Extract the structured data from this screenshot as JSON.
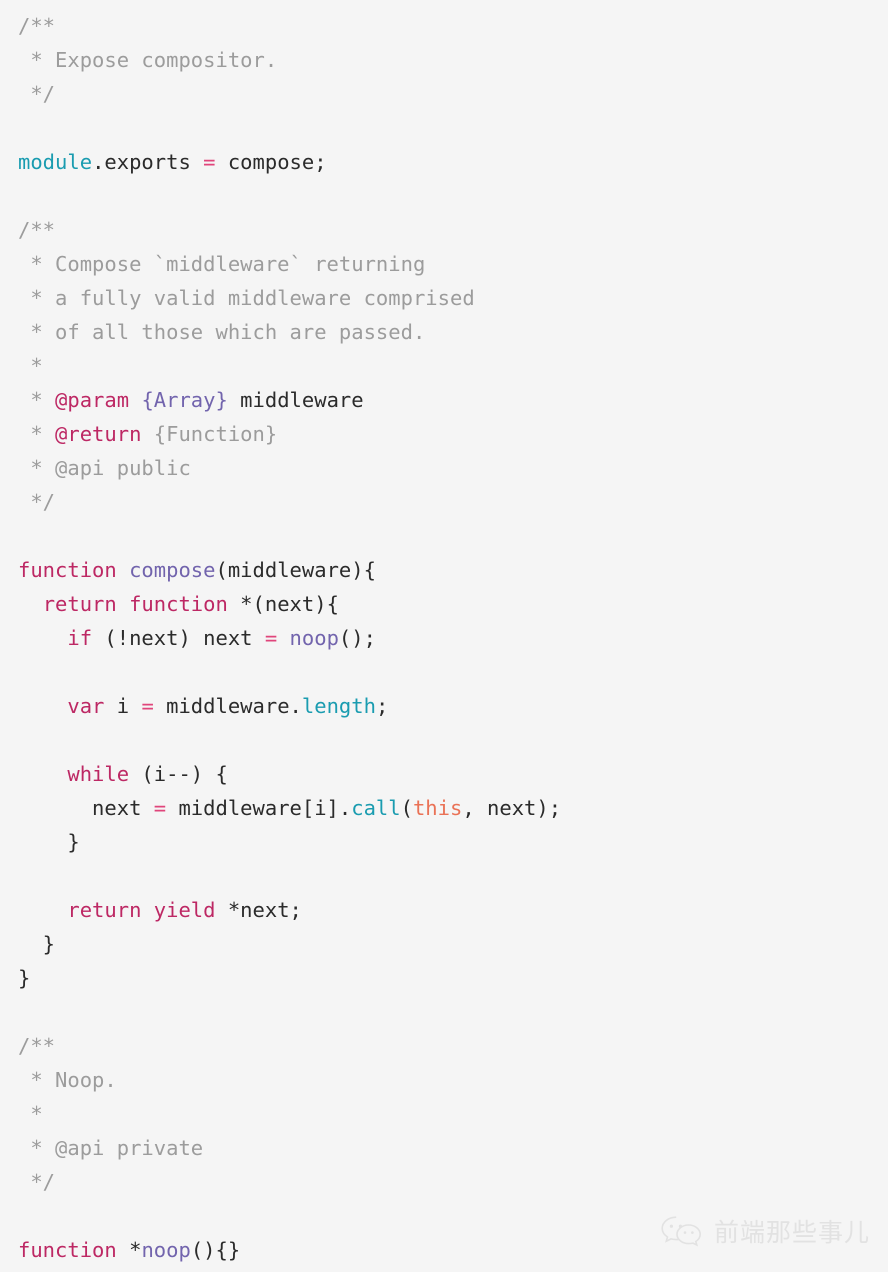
{
  "document": {
    "kind": "source-code-screenshot",
    "language": "javascript",
    "background_color": "#f5f5f5"
  },
  "theme": {
    "comment": "#9c9c9c",
    "keyword": "#bd2864",
    "operator": "#e0457b",
    "function": "#7264ad",
    "property": "#1a9cb0",
    "this_keyword": "#ea7256",
    "plain": "#2b2b2b",
    "watermark": "#e2e2e2"
  },
  "code": {
    "lines": [
      {
        "id": "l1",
        "tokens": [
          {
            "t": "/**",
            "c": "t-comment"
          }
        ]
      },
      {
        "id": "l2",
        "tokens": [
          {
            "t": " * Expose compositor.",
            "c": "t-comment"
          }
        ]
      },
      {
        "id": "l3",
        "tokens": [
          {
            "t": " */",
            "c": "t-comment"
          }
        ]
      },
      {
        "id": "l4",
        "tokens": [
          {
            "t": "",
            "c": "t-plain"
          }
        ]
      },
      {
        "id": "l5",
        "tokens": [
          {
            "t": "module",
            "c": "t-builtin"
          },
          {
            "t": ".exports ",
            "c": "t-plain"
          },
          {
            "t": "=",
            "c": "t-operator"
          },
          {
            "t": " compose;",
            "c": "t-plain"
          }
        ]
      },
      {
        "id": "l6",
        "tokens": [
          {
            "t": "",
            "c": "t-plain"
          }
        ]
      },
      {
        "id": "l7",
        "tokens": [
          {
            "t": "/**",
            "c": "t-comment"
          }
        ]
      },
      {
        "id": "l8",
        "tokens": [
          {
            "t": " * Compose `middleware` returning",
            "c": "t-comment"
          }
        ]
      },
      {
        "id": "l9",
        "tokens": [
          {
            "t": " * a fully valid middleware comprised",
            "c": "t-comment"
          }
        ]
      },
      {
        "id": "l10",
        "tokens": [
          {
            "t": " * of all those which are passed.",
            "c": "t-comment"
          }
        ]
      },
      {
        "id": "l11",
        "tokens": [
          {
            "t": " *",
            "c": "t-comment"
          }
        ]
      },
      {
        "id": "l12",
        "tokens": [
          {
            "t": " * ",
            "c": "t-comment"
          },
          {
            "t": "@param",
            "c": "t-tag"
          },
          {
            "t": " ",
            "c": "t-comment"
          },
          {
            "t": "{Array}",
            "c": "t-type"
          },
          {
            "t": " middleware",
            "c": "t-plain"
          }
        ]
      },
      {
        "id": "l13",
        "tokens": [
          {
            "t": " * ",
            "c": "t-comment"
          },
          {
            "t": "@return",
            "c": "t-tag"
          },
          {
            "t": " {Function}",
            "c": "t-comment"
          }
        ]
      },
      {
        "id": "l14",
        "tokens": [
          {
            "t": " * @api public",
            "c": "t-comment"
          }
        ]
      },
      {
        "id": "l15",
        "tokens": [
          {
            "t": " */",
            "c": "t-comment"
          }
        ]
      },
      {
        "id": "l16",
        "tokens": [
          {
            "t": "",
            "c": "t-plain"
          }
        ]
      },
      {
        "id": "l17",
        "tokens": [
          {
            "t": "function",
            "c": "t-keyword"
          },
          {
            "t": " ",
            "c": "t-plain"
          },
          {
            "t": "compose",
            "c": "t-function"
          },
          {
            "t": "(middleware){",
            "c": "t-plain"
          }
        ]
      },
      {
        "id": "l18",
        "tokens": [
          {
            "t": "  ",
            "c": "t-plain"
          },
          {
            "t": "return",
            "c": "t-keyword"
          },
          {
            "t": " ",
            "c": "t-plain"
          },
          {
            "t": "function",
            "c": "t-keyword"
          },
          {
            "t": " *(next){",
            "c": "t-plain"
          }
        ]
      },
      {
        "id": "l19",
        "tokens": [
          {
            "t": "    ",
            "c": "t-plain"
          },
          {
            "t": "if",
            "c": "t-keyword"
          },
          {
            "t": " (!next) next ",
            "c": "t-plain"
          },
          {
            "t": "=",
            "c": "t-operator"
          },
          {
            "t": " ",
            "c": "t-plain"
          },
          {
            "t": "noop",
            "c": "t-function"
          },
          {
            "t": "();",
            "c": "t-plain"
          }
        ]
      },
      {
        "id": "l20",
        "tokens": [
          {
            "t": "",
            "c": "t-plain"
          }
        ]
      },
      {
        "id": "l21",
        "tokens": [
          {
            "t": "    ",
            "c": "t-plain"
          },
          {
            "t": "var",
            "c": "t-keyword"
          },
          {
            "t": " i ",
            "c": "t-plain"
          },
          {
            "t": "=",
            "c": "t-operator"
          },
          {
            "t": " middleware.",
            "c": "t-plain"
          },
          {
            "t": "length",
            "c": "t-property"
          },
          {
            "t": ";",
            "c": "t-plain"
          }
        ]
      },
      {
        "id": "l22",
        "tokens": [
          {
            "t": "",
            "c": "t-plain"
          }
        ]
      },
      {
        "id": "l23",
        "tokens": [
          {
            "t": "    ",
            "c": "t-plain"
          },
          {
            "t": "while",
            "c": "t-keyword"
          },
          {
            "t": " (i--) {",
            "c": "t-plain"
          }
        ]
      },
      {
        "id": "l24",
        "tokens": [
          {
            "t": "      next ",
            "c": "t-plain"
          },
          {
            "t": "=",
            "c": "t-operator"
          },
          {
            "t": " middleware[i].",
            "c": "t-plain"
          },
          {
            "t": "call",
            "c": "t-property"
          },
          {
            "t": "(",
            "c": "t-plain"
          },
          {
            "t": "this",
            "c": "t-this"
          },
          {
            "t": ", next);",
            "c": "t-plain"
          }
        ]
      },
      {
        "id": "l25",
        "tokens": [
          {
            "t": "    }",
            "c": "t-plain"
          }
        ]
      },
      {
        "id": "l26",
        "tokens": [
          {
            "t": "",
            "c": "t-plain"
          }
        ]
      },
      {
        "id": "l27",
        "tokens": [
          {
            "t": "    ",
            "c": "t-plain"
          },
          {
            "t": "return",
            "c": "t-keyword"
          },
          {
            "t": " ",
            "c": "t-plain"
          },
          {
            "t": "yield",
            "c": "t-keyword"
          },
          {
            "t": " *next;",
            "c": "t-plain"
          }
        ]
      },
      {
        "id": "l28",
        "tokens": [
          {
            "t": "  }",
            "c": "t-plain"
          }
        ]
      },
      {
        "id": "l29",
        "tokens": [
          {
            "t": "}",
            "c": "t-plain"
          }
        ]
      },
      {
        "id": "l30",
        "tokens": [
          {
            "t": "",
            "c": "t-plain"
          }
        ]
      },
      {
        "id": "l31",
        "tokens": [
          {
            "t": "/**",
            "c": "t-comment"
          }
        ]
      },
      {
        "id": "l32",
        "tokens": [
          {
            "t": " * Noop.",
            "c": "t-comment"
          }
        ]
      },
      {
        "id": "l33",
        "tokens": [
          {
            "t": " *",
            "c": "t-comment"
          }
        ]
      },
      {
        "id": "l34",
        "tokens": [
          {
            "t": " * @api private",
            "c": "t-comment"
          }
        ]
      },
      {
        "id": "l35",
        "tokens": [
          {
            "t": " */",
            "c": "t-comment"
          }
        ]
      },
      {
        "id": "l36",
        "tokens": [
          {
            "t": "",
            "c": "t-plain"
          }
        ]
      },
      {
        "id": "l37",
        "tokens": [
          {
            "t": "function",
            "c": "t-keyword"
          },
          {
            "t": " *",
            "c": "t-plain"
          },
          {
            "t": "noop",
            "c": "t-function"
          },
          {
            "t": "(){}",
            "c": "t-plain"
          }
        ]
      }
    ]
  },
  "watermark": {
    "icon": "wechat-icon",
    "text": "前端那些事儿"
  }
}
